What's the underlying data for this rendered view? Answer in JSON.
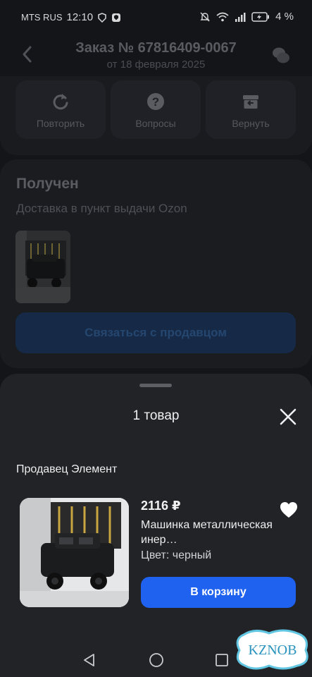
{
  "status_bar": {
    "carrier": "MTS RUS",
    "time": "12:10",
    "battery": "4 %"
  },
  "header": {
    "title": "Заказ № 67816409-0067",
    "subtitle": "от 18 февраля 2025"
  },
  "actions": [
    {
      "label": "Повторить",
      "icon": "repeat-icon"
    },
    {
      "label": "Вопросы",
      "icon": "question-icon"
    },
    {
      "label": "Вернуть",
      "icon": "return-box-icon"
    }
  ],
  "order_status": {
    "title": "Получен",
    "subtitle": "Доставка в пункт выдачи Ozon",
    "contact_button": "Связаться с продавцом"
  },
  "sheet": {
    "title": "1 товар",
    "seller": "Продавец Элемент",
    "product": {
      "price": "2116 ₽",
      "name": "Машинка металлическая инер…",
      "color": "Цвет: черный",
      "cart_button": "В корзину"
    }
  },
  "watermark": "KZNOB",
  "colors": {
    "accent": "#1f62f0",
    "sheet_bg": "#222327",
    "background": "#141518"
  }
}
